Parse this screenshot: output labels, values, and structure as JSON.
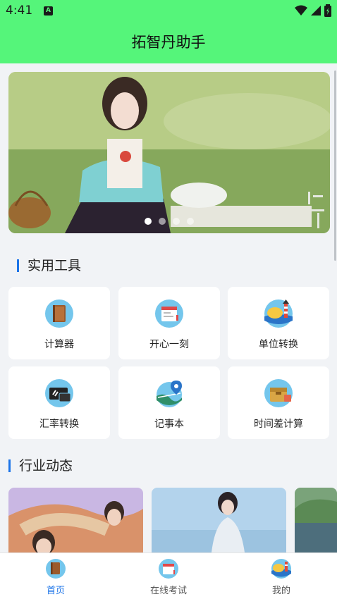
{
  "status_bar": {
    "time": "4:41",
    "notif_letter": "A"
  },
  "app": {
    "title": "拓智丹助手",
    "accent": "#55f57a",
    "highlight": "#1c74e8"
  },
  "banner": {
    "calligraphy": "永夜星河",
    "slides": 4,
    "active_slide": 1
  },
  "tools_section": {
    "title": "实用工具",
    "tools": [
      {
        "label": "计算器",
        "icon": "notebook-icon"
      },
      {
        "label": "开心一刻",
        "icon": "calendar-icon"
      },
      {
        "label": "单位转换",
        "icon": "lighthouse-icon"
      },
      {
        "label": "汇率转换",
        "icon": "monitor-icon"
      },
      {
        "label": "记事本",
        "icon": "map-pin-icon"
      },
      {
        "label": "时间差计算",
        "icon": "toolbox-icon"
      }
    ]
  },
  "news_section": {
    "title": "行业动态"
  },
  "bottom_nav": {
    "items": [
      {
        "label": "首页",
        "icon": "notebook-icon",
        "active": true
      },
      {
        "label": "在线考试",
        "icon": "calendar-icon",
        "active": false
      },
      {
        "label": "我的",
        "icon": "lighthouse-icon",
        "active": false
      }
    ]
  }
}
